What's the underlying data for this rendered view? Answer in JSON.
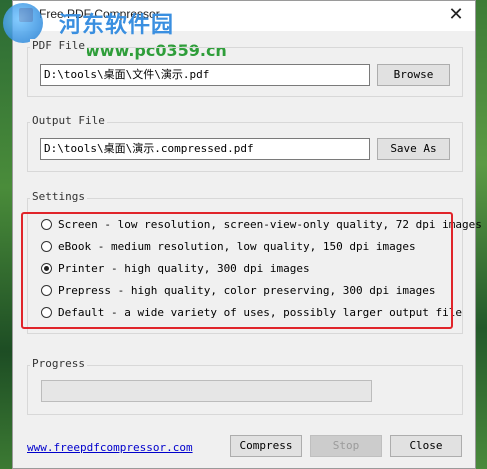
{
  "window": {
    "title": "Free PDF Compressor",
    "close_glyph": "✕"
  },
  "watermark": {
    "cn_text": "河东软件园",
    "url_text": "www.pc0359.cn"
  },
  "pdf_file": {
    "label": "PDF File",
    "value": "D:\\tools\\桌面\\文件\\演示.pdf",
    "button": "Browse"
  },
  "output_file": {
    "label": "Output File",
    "value": "D:\\tools\\桌面\\演示.compressed.pdf",
    "button": "Save As"
  },
  "settings": {
    "label": "Settings",
    "options": [
      {
        "label": "Screen - low resolution, screen-view-only quality, 72 dpi images",
        "checked": false
      },
      {
        "label": "eBook - medium resolution, low quality, 150 dpi images",
        "checked": false
      },
      {
        "label": "Printer - high quality, 300 dpi images",
        "checked": true
      },
      {
        "label": "Prepress - high quality, color preserving, 300 dpi images",
        "checked": false
      },
      {
        "label": "Default - a wide variety of uses, possibly larger output file",
        "checked": false
      }
    ],
    "highlight_color": "#e0242a"
  },
  "progress": {
    "label": "Progress",
    "value": 0
  },
  "footer": {
    "link": "www.freepdfcompressor.com",
    "compress": "Compress",
    "stop": "Stop",
    "close": "Close"
  }
}
